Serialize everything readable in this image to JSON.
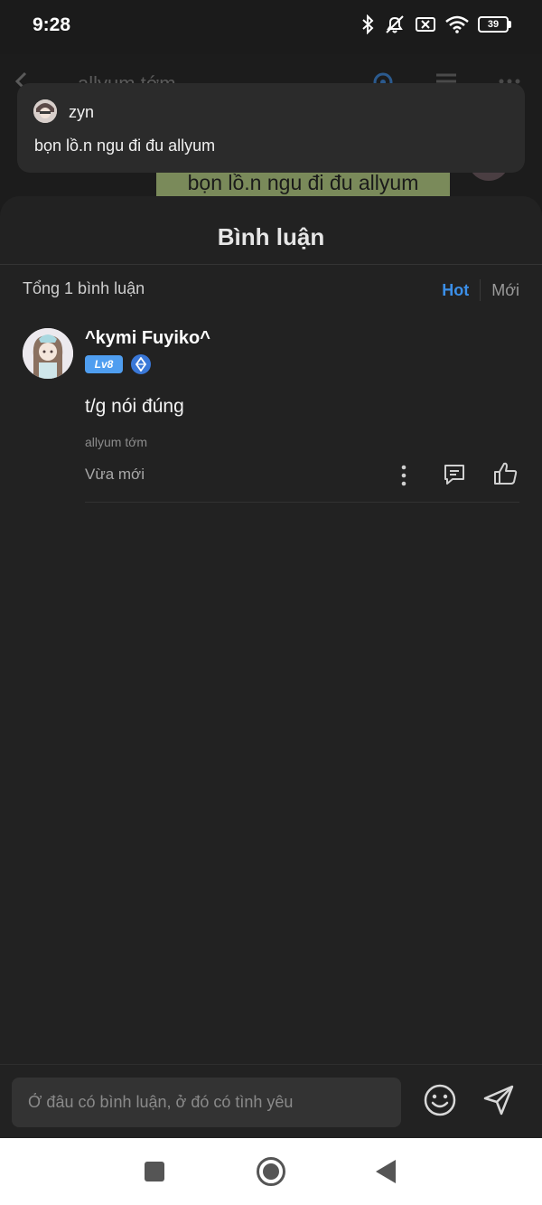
{
  "status_bar": {
    "time": "9:28",
    "battery": "39",
    "icons": [
      "bluetooth-icon",
      "bell-muted-icon",
      "no-sim-icon",
      "wifi-icon",
      "battery-icon"
    ]
  },
  "reader": {
    "title": "allyum tớm",
    "highlighted_text": "bọn lồ.n ngu đi đu allyum"
  },
  "notification": {
    "sender": "zyn",
    "message": "bọn lồ.n ngu đi đu allyum"
  },
  "comments": {
    "title": "Bình luận",
    "total": "Tổng 1 bình luận",
    "sort": {
      "hot": "Hot",
      "new": "Mới"
    },
    "active_sort": "Hot",
    "accent_color": "#3b8fe8",
    "items": [
      {
        "author": "^kymi Fuyiko^",
        "level": "Lv8",
        "text": "t/g nói đúng",
        "source": "allyum tớm",
        "time": "Vừa mới"
      }
    ]
  },
  "input": {
    "placeholder": "Ở đâu có bình luận, ở đó có tình yêu"
  }
}
